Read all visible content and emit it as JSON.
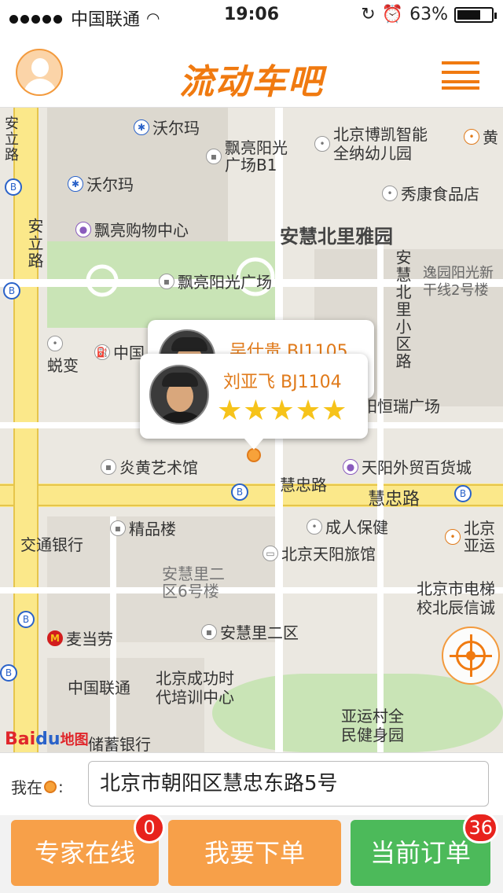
{
  "status_bar": {
    "carrier": "中国联通",
    "time": "19:06",
    "battery": "63%",
    "battery_level": 0.63
  },
  "header": {
    "logo_text": "流动车吧",
    "avatar_icon": "user-avatar-icon",
    "menu_icon": "menu-icon"
  },
  "map": {
    "pois": {
      "walmart1": "沃尔玛",
      "walmart2": "沃尔玛",
      "piaoliang_guangchang_b1": "飘亮阳光\n广场B1",
      "piaoliang_shopping": "飘亮购物中心",
      "piaoliang_guangchang": "飘亮阳光广场",
      "kindergarten": "北京博凯智能\n全纳幼儿园",
      "xiukang": "秀康食品店",
      "anhui_beili_yayuan": "安慧北里雅园",
      "yiyuan": "逸园阳光新\n干线2号楼",
      "anhui_beili_xiaoqu": "安慧北里小区路",
      "zhongguo": "中国",
      "wubian": "蜕变",
      "tianyang_guangchang": "天阳恒瑞广场",
      "yanhuang": "炎黄艺术馆",
      "tianyang_store": "天阳外贸百货城",
      "huizhong_lu_small": "慧忠路",
      "huizhong_lu": "慧忠路",
      "jiaotong_bank": "交通银行",
      "jingpin": "精品楼",
      "chengren": "成人保健",
      "anhuili_2": "安慧里二\n区6号楼",
      "tianyang_hotel": "北京天阳旅馆",
      "mcdonalds": "麦当劳",
      "anhuili_2qu": "安慧里二区",
      "elevator": "北京市电梯\n校北辰信诚",
      "unicom": "中国联通",
      "chenggong": "北京成功时\n代培训中心",
      "yayun": "亚运村全\n民健身园",
      "postal": "储蓄银行",
      "anli_road_left": "安立路",
      "anli_road": "安立路",
      "huang": "黄",
      "beiya": "北京\n亚运"
    },
    "popup_back": {
      "driver": "吴仕贵 BJ1105"
    },
    "popup_front": {
      "driver": "刘亚飞 BJ1104",
      "rating": 5,
      "stars": "★★★★★"
    },
    "baidu_logo": {
      "bai": "Bai",
      "du": "du",
      "map": "地图"
    }
  },
  "location": {
    "label": "我在",
    "colon": ":",
    "address": "北京市朝阳区慧忠东路5号"
  },
  "buttons": [
    {
      "label": "专家在线",
      "badge": "0",
      "color": "#f7a049"
    },
    {
      "label": "我要下单",
      "badge": "",
      "color": "#f7a049"
    },
    {
      "label": "当前订单",
      "badge": "36",
      "color": "#4cba5a"
    }
  ]
}
